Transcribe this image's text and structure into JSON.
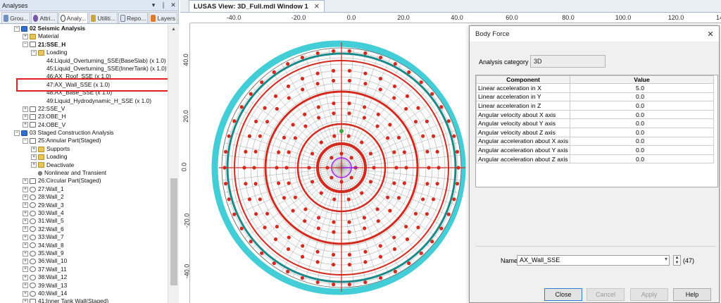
{
  "left_panel": {
    "title": "Analyses",
    "controls": [
      "▾",
      "❘",
      "✕"
    ],
    "tabs": [
      "Grou...",
      "Attri...",
      "Analy...",
      "Utiliti...",
      "Repo...",
      "Layers"
    ],
    "tree": [
      {
        "label": "02 Seismic Analysis",
        "indent": 1,
        "exp": "⊟",
        "icon": "ana",
        "bold": true,
        "prefix": "≡ "
      },
      {
        "label": "Material",
        "indent": 2,
        "exp": "⊞",
        "icon": "folder"
      },
      {
        "label": "21:SSE_H",
        "indent": 2,
        "exp": "⊟",
        "icon": "lc",
        "bold": true
      },
      {
        "label": "Loading",
        "indent": 3,
        "exp": "⊟",
        "icon": "folder"
      },
      {
        "label": "44:Liquid_Overturning_SSE(BaseSlab) (x 1.0)",
        "indent": 4,
        "exp": "",
        "icon": "none"
      },
      {
        "label": "45:Liquid_Overturning_SSE(InnerTank) (x 1.0)",
        "indent": 4,
        "exp": "",
        "icon": "none"
      },
      {
        "label": "46:AX_Roof_SSE (x 1.0)",
        "indent": 4,
        "exp": "",
        "icon": "none"
      },
      {
        "label": "47:AX_Wall_SSE (x 1.0)",
        "indent": 4,
        "exp": "",
        "icon": "none"
      },
      {
        "label": "48:AX_Base_SSE (x 1.0)",
        "indent": 4,
        "exp": "",
        "icon": "none"
      },
      {
        "label": "49:Liquid_Hydrodynamic_H_SSE (x 1.0)",
        "indent": 4,
        "exp": "",
        "icon": "none"
      },
      {
        "label": "22:SSE_V",
        "indent": 2,
        "exp": "⊞",
        "icon": "lc"
      },
      {
        "label": "23:OBE_H",
        "indent": 2,
        "exp": "⊞",
        "icon": "lc"
      },
      {
        "label": "24:OBE_V",
        "indent": 2,
        "exp": "⊞",
        "icon": "lc"
      },
      {
        "label": "03 Staged Construction Analysis",
        "indent": 1,
        "exp": "⊟",
        "icon": "ana",
        "prefix": "≡ "
      },
      {
        "label": "25:Annular Part(Staged)",
        "indent": 2,
        "exp": "⊟",
        "icon": "lc"
      },
      {
        "label": "Supports",
        "indent": 3,
        "exp": "⊞",
        "icon": "folder"
      },
      {
        "label": "Loading",
        "indent": 3,
        "exp": "⊞",
        "icon": "folder"
      },
      {
        "label": "Deactivate",
        "indent": 3,
        "exp": "⊞",
        "icon": "folder"
      },
      {
        "label": "Nonlinear and Transient",
        "indent": 3,
        "exp": "",
        "icon": "wrench"
      },
      {
        "label": "26:Circular Part(Staged)",
        "indent": 2,
        "exp": "⊞",
        "icon": "lc"
      },
      {
        "label": "27:Wall_1",
        "indent": 2,
        "exp": "⊞",
        "icon": "wall"
      },
      {
        "label": "28:Wall_2",
        "indent": 2,
        "exp": "⊞",
        "icon": "wall"
      },
      {
        "label": "29:Wall_3",
        "indent": 2,
        "exp": "⊞",
        "icon": "wall"
      },
      {
        "label": "30:Wall_4",
        "indent": 2,
        "exp": "⊞",
        "icon": "wall"
      },
      {
        "label": "31:Wall_5",
        "indent": 2,
        "exp": "⊞",
        "icon": "wall"
      },
      {
        "label": "32:Wall_6",
        "indent": 2,
        "exp": "⊞",
        "icon": "wall"
      },
      {
        "label": "33:Wall_7",
        "indent": 2,
        "exp": "⊞",
        "icon": "wall"
      },
      {
        "label": "34:Wall_8",
        "indent": 2,
        "exp": "⊞",
        "icon": "wall"
      },
      {
        "label": "35:Wall_9",
        "indent": 2,
        "exp": "⊞",
        "icon": "wall"
      },
      {
        "label": "36:Wall_10",
        "indent": 2,
        "exp": "⊞",
        "icon": "wall"
      },
      {
        "label": "37:Wall_11",
        "indent": 2,
        "exp": "⊞",
        "icon": "wall"
      },
      {
        "label": "38:Wall_12",
        "indent": 2,
        "exp": "⊞",
        "icon": "wall"
      },
      {
        "label": "39:Wall_13",
        "indent": 2,
        "exp": "⊞",
        "icon": "wall"
      },
      {
        "label": "40:Wall_14",
        "indent": 2,
        "exp": "⊞",
        "icon": "wall"
      },
      {
        "label": "41:Inner Tank Wall(Staged)",
        "indent": 2,
        "exp": "⊞",
        "icon": "lc"
      }
    ]
  },
  "view": {
    "tab_label": "LUSAS View: 3D_Full.mdl Window 1",
    "ruler_top": [
      "-40.0",
      "-20.0",
      "0.0",
      "20.0",
      "40.0",
      "60.0",
      "80.0",
      "100.0",
      "120.0",
      "14"
    ],
    "ruler_left": [
      "40.0",
      "20.0",
      "0.0",
      "-20.0",
      "-40.0"
    ]
  },
  "dialog": {
    "title": "Body Force",
    "analysis_category_label": "Analysis category",
    "analysis_category_value": "3D",
    "col_component": "Component",
    "col_value": "Value",
    "rows": [
      {
        "component": "Linear acceleration in X",
        "value": "5.0"
      },
      {
        "component": "Linear acceleration in Y",
        "value": "0.0"
      },
      {
        "component": "Linear acceleration in Z",
        "value": "0.0"
      },
      {
        "component": "Angular velocity about X axis",
        "value": "0.0"
      },
      {
        "component": "Angular velocity about Y axis",
        "value": "0.0"
      },
      {
        "component": "Angular velocity about Z axis",
        "value": "0.0"
      },
      {
        "component": "Angular acceleration about X axis",
        "value": "0.0"
      },
      {
        "component": "Angular acceleration about Y axis",
        "value": "0.0"
      },
      {
        "component": "Angular acceleration about Z axis",
        "value": "0.0"
      }
    ],
    "name_label": "Name",
    "name_value": "AX_Wall_SSE",
    "name_count": "(47)",
    "buttons": {
      "close": "Close",
      "cancel": "Cancel",
      "apply": "Apply",
      "help": "Help"
    }
  },
  "colors": {
    "load_red": "#d42a1e",
    "mesh_teal": "#1a8a8a",
    "outline_cyan": "#22c6d0",
    "support_magenta": "#a020f0",
    "highlight_red": "#e21f1f"
  }
}
